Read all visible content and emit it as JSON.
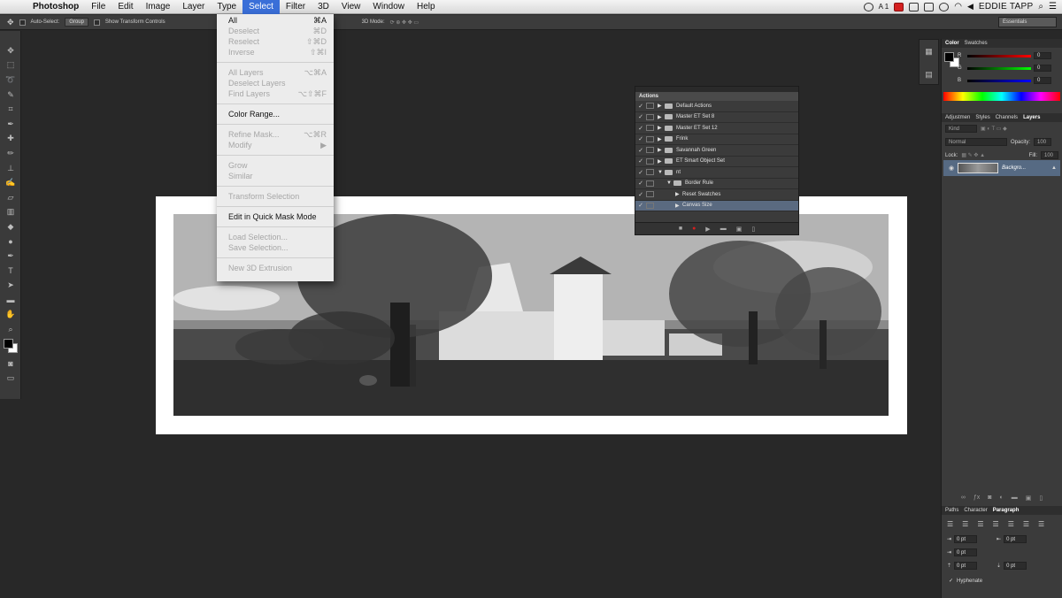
{
  "menubar": {
    "app": "Photoshop",
    "items": [
      "File",
      "Edit",
      "Image",
      "Layer",
      "Type",
      "Select",
      "Filter",
      "3D",
      "View",
      "Window",
      "Help"
    ],
    "active_item": "Select",
    "user": "EDDIE TAPP",
    "status_icons": [
      "creative-cloud-icon",
      "adobe-icon",
      "record-icon",
      "display-icon",
      "battery-icon",
      "volume-icon",
      "time-machine-icon",
      "wifi-icon",
      "flag-icon",
      "volume-icon"
    ],
    "input_badge": "A 1"
  },
  "options": {
    "auto_select": "Auto-Select:",
    "group": "Group",
    "show_transform": "Show Transform Controls",
    "mode_3d": "3D Mode:",
    "workspace": "Essentials"
  },
  "select_menu": {
    "items": [
      {
        "label": "All",
        "shortcut": "⌘A",
        "disabled": false
      },
      {
        "label": "Deselect",
        "shortcut": "⌘D",
        "disabled": true
      },
      {
        "label": "Reselect",
        "shortcut": "⇧⌘D",
        "disabled": true
      },
      {
        "label": "Inverse",
        "shortcut": "⇧⌘I",
        "disabled": true
      },
      {
        "sep": true
      },
      {
        "label": "All Layers",
        "shortcut": "⌥⌘A",
        "disabled": true
      },
      {
        "label": "Deselect Layers",
        "shortcut": "",
        "disabled": true
      },
      {
        "label": "Find Layers",
        "shortcut": "⌥⇧⌘F",
        "disabled": true
      },
      {
        "sep": true
      },
      {
        "label": "Color Range...",
        "shortcut": "",
        "disabled": false
      },
      {
        "sep": true
      },
      {
        "label": "Refine Mask...",
        "shortcut": "⌥⌘R",
        "disabled": true
      },
      {
        "label": "Modify",
        "shortcut": "▶",
        "disabled": true
      },
      {
        "sep": true
      },
      {
        "label": "Grow",
        "shortcut": "",
        "disabled": true
      },
      {
        "label": "Similar",
        "shortcut": "",
        "disabled": true
      },
      {
        "sep": true
      },
      {
        "label": "Transform Selection",
        "shortcut": "",
        "disabled": true
      },
      {
        "sep": true
      },
      {
        "label": "Edit in Quick Mask Mode",
        "shortcut": "",
        "disabled": false
      },
      {
        "sep": true
      },
      {
        "label": "Load Selection...",
        "shortcut": "",
        "disabled": true
      },
      {
        "label": "Save Selection...",
        "shortcut": "",
        "disabled": true
      },
      {
        "sep": true
      },
      {
        "label": "New 3D Extrusion",
        "shortcut": "",
        "disabled": true
      }
    ]
  },
  "actions_panel": {
    "title": "Actions",
    "rows": [
      {
        "label": "Default Actions",
        "level": 0,
        "expanded": false,
        "check": "✓"
      },
      {
        "label": "Master ET Set 8",
        "level": 0,
        "expanded": false,
        "check": "✓"
      },
      {
        "label": "Master ET Set 12",
        "level": 0,
        "expanded": false,
        "check": "✓"
      },
      {
        "label": "Frink",
        "level": 0,
        "expanded": false,
        "check": "✓"
      },
      {
        "label": "Savannah Green",
        "level": 0,
        "expanded": false,
        "check": "✓"
      },
      {
        "label": "ET Smart Object Set",
        "level": 0,
        "expanded": false,
        "check": "✓"
      },
      {
        "label": "nt",
        "level": 0,
        "expanded": true,
        "check": "✓"
      },
      {
        "label": "Border Rule",
        "level": 1,
        "expanded": true,
        "check": "✓"
      },
      {
        "label": "Reset Swatches",
        "level": 2,
        "expanded": false,
        "check": "✓"
      },
      {
        "label": "Canvas Size",
        "level": 2,
        "expanded": false,
        "check": "✓",
        "selected": true
      }
    ]
  },
  "color_panel": {
    "tabs": [
      "Color",
      "Swatches"
    ],
    "active_tab": "Color",
    "r": "0",
    "g": "0",
    "b": "0",
    "labels": {
      "r": "R",
      "g": "G",
      "b": "B"
    }
  },
  "layers_panel": {
    "tabs": [
      "Adjustmen",
      "Styles",
      "Channels",
      "Layers"
    ],
    "active_tab": "Layers",
    "kind": "Kind",
    "blend": "Normal",
    "opacity_label": "Opacity:",
    "opacity_value": "100",
    "lock_label": "Lock:",
    "fill_label": "Fill:",
    "fill_value": "100",
    "layer_name": "Backgro..."
  },
  "paragraph_panel": {
    "tabs": [
      "Paths",
      "Character",
      "Paragraph"
    ],
    "active_tab": "Paragraph",
    "indent_left": "0 pt",
    "indent_right": "0 pt",
    "first_line": "0 pt",
    "space_before": "0 pt",
    "space_after": "0 pt",
    "hyphenate": "Hyphenate"
  },
  "colors": {
    "menu_highlight": "#3a6fd8",
    "panel_bg": "#3b3b3b",
    "workspace_bg": "#282828",
    "record_red": "#d42020"
  }
}
